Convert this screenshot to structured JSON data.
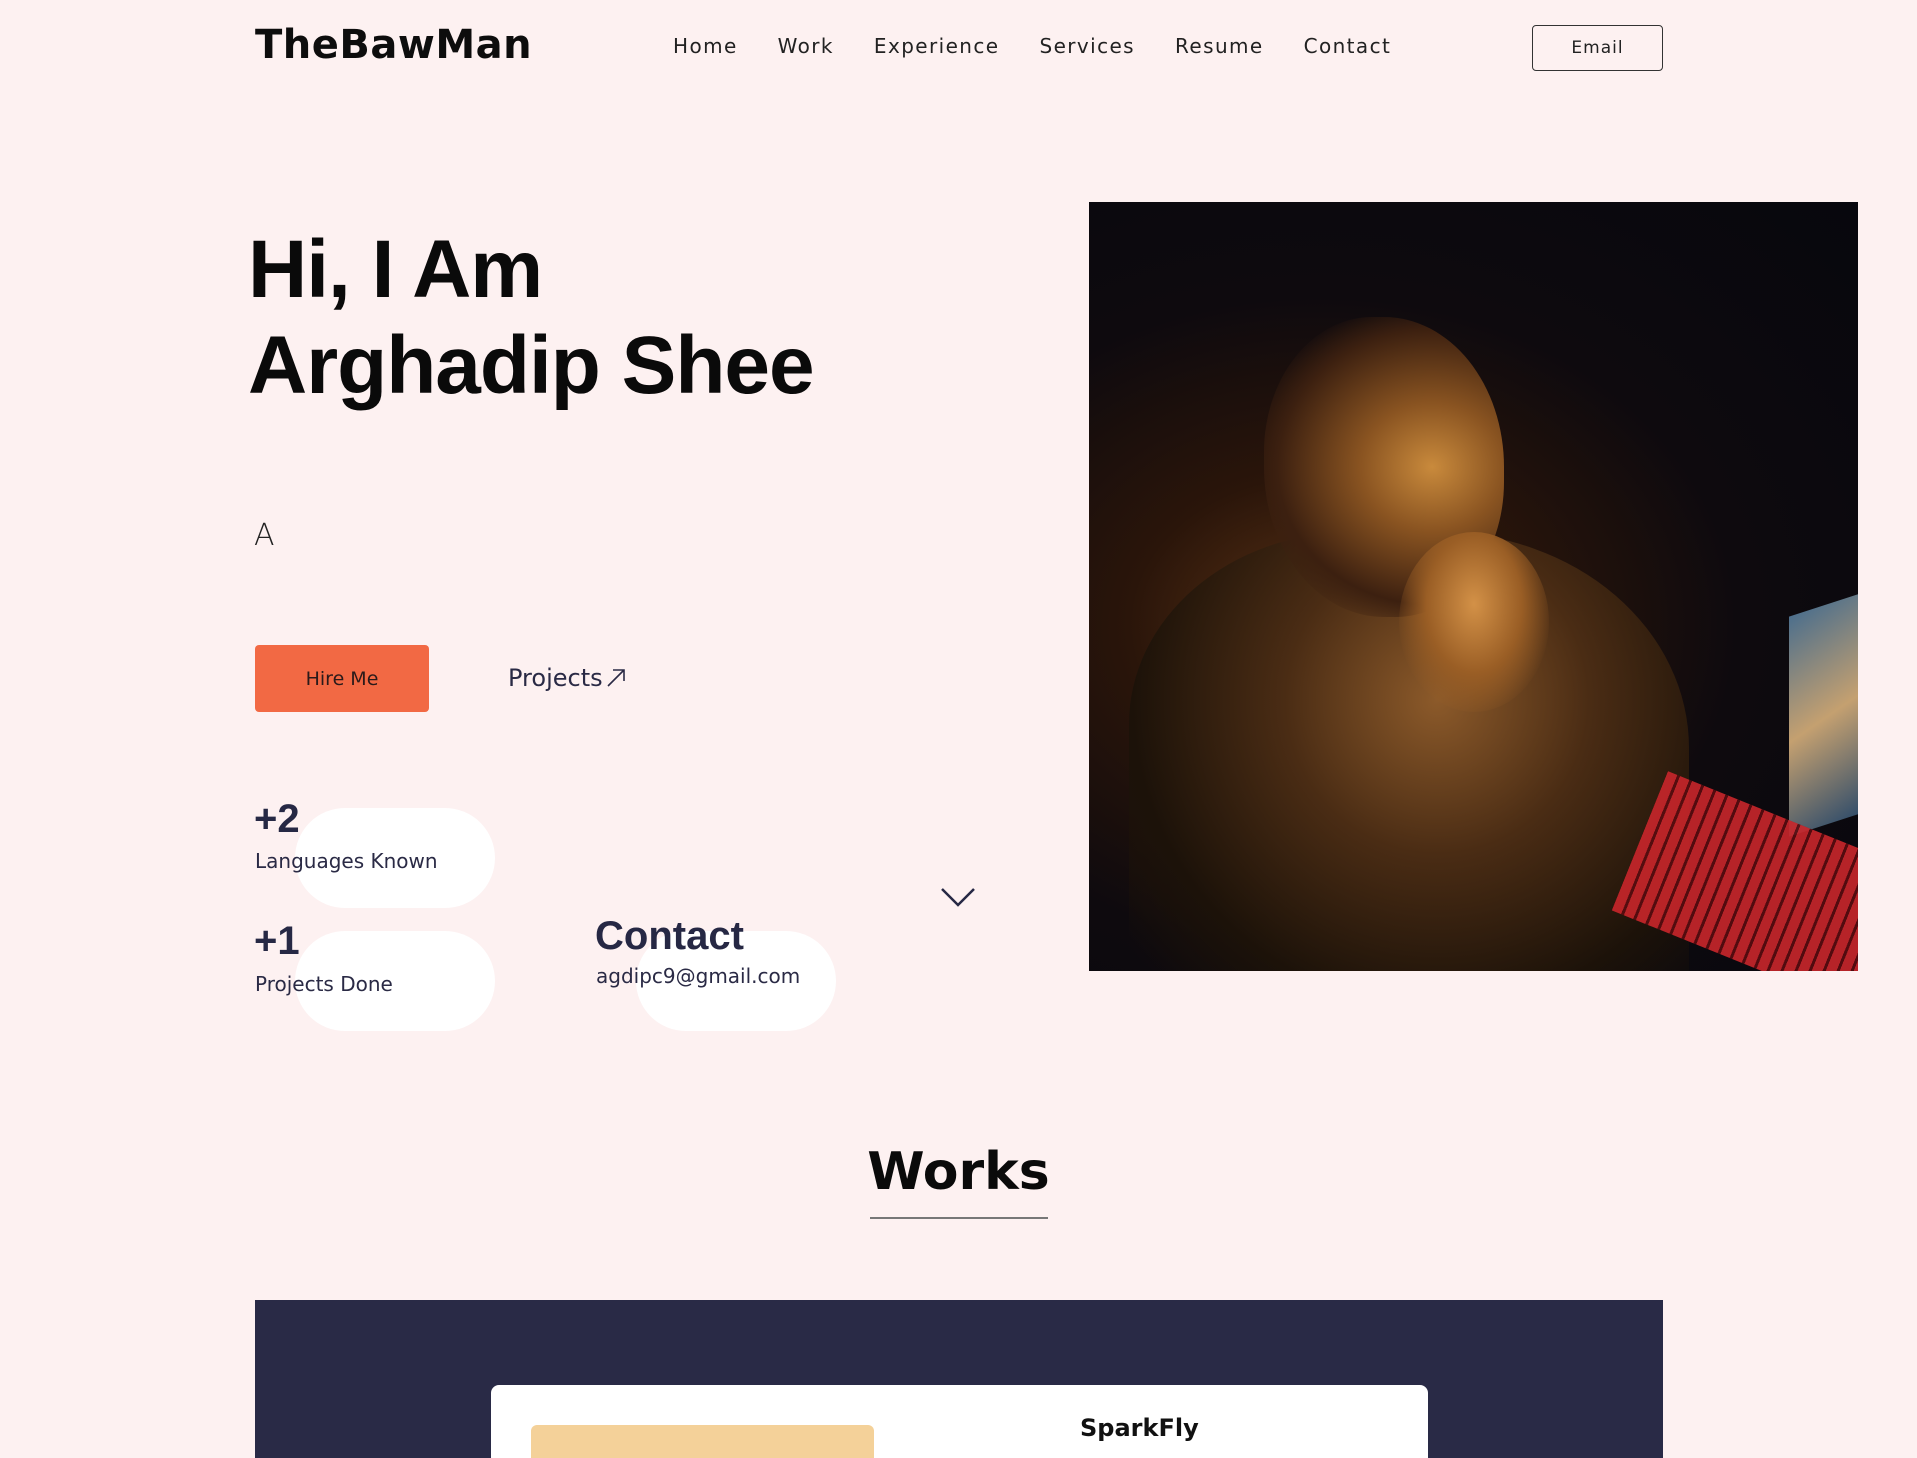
{
  "header": {
    "brand": "TheBawMan",
    "nav": [
      "Home",
      "Work",
      "Experience",
      "Services",
      "Resume",
      "Contact"
    ],
    "email_button": "Email"
  },
  "hero": {
    "title_line1": "Hi, I Am",
    "title_line2": "Arghadip Shee",
    "typed_text": "A",
    "hire_button": "Hire Me",
    "projects_link": "Projects",
    "stats": [
      {
        "number": "+2",
        "label": "Languages Known"
      },
      {
        "number": "+1",
        "label": "Projects Done"
      }
    ],
    "contact": {
      "title": "Contact",
      "email": "agdipc9@gmail.com"
    }
  },
  "works": {
    "title": "Works",
    "cards": [
      {
        "name": "SparkFly"
      }
    ]
  },
  "colors": {
    "background": "#fdf1f1",
    "accent": "#f26944",
    "navy": "#292a46",
    "thumb": "#f4d199"
  },
  "icons": [
    "arrow-up-right-icon",
    "chevron-down-icon"
  ]
}
